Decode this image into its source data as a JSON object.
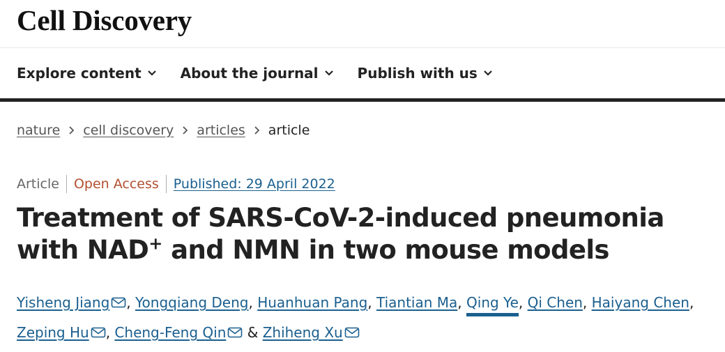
{
  "header": {
    "journal_title": "Cell Discovery"
  },
  "nav": {
    "items": [
      {
        "label": "Explore content",
        "icon": "chevron-down-icon"
      },
      {
        "label": "About the journal",
        "icon": "chevron-down-icon"
      },
      {
        "label": "Publish with us",
        "icon": "chevron-down-icon"
      }
    ]
  },
  "breadcrumb": {
    "items": [
      "nature",
      "cell discovery",
      "articles"
    ],
    "current": "article",
    "separator_icon": "chevron-right-icon"
  },
  "article": {
    "type": "Article",
    "access": "Open Access",
    "published": "Published: 29 April 2022",
    "title_part1": "Treatment of SARS-CoV-2-induced pneumonia with NAD",
    "title_sup": "+",
    "title_part2": " and NMN in two mouse models",
    "authors": [
      {
        "name": "Yisheng Jiang",
        "email": true,
        "sep": ", "
      },
      {
        "name": "Yongqiang Deng",
        "email": false,
        "sep": ", "
      },
      {
        "name": "Huanhuan Pang",
        "email": false,
        "sep": ", "
      },
      {
        "name": "Tiantian Ma",
        "email": false,
        "sep": ", "
      },
      {
        "name": "Qing Ye",
        "email": false,
        "sep": ", "
      },
      {
        "name": "Qi Chen",
        "email": false,
        "sep": ", "
      },
      {
        "name": "Haiyang Chen",
        "email": false,
        "sep": ", "
      },
      {
        "name": "Zeping Hu",
        "email": true,
        "sep": ", "
      },
      {
        "name": "Cheng-Feng Qin",
        "email": true,
        "sep": " & "
      },
      {
        "name": "Zhiheng Xu",
        "email": true,
        "sep": ""
      }
    ]
  },
  "colors": {
    "link": "#1a5f8f",
    "open_access": "#b24f30",
    "text": "#222222",
    "muted": "#666666"
  }
}
